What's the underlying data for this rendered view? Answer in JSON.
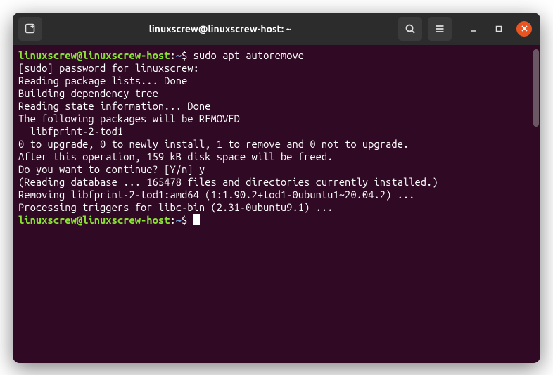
{
  "window": {
    "title": "linuxscrew@linuxscrew-host: ~"
  },
  "prompt": {
    "user_host": "linuxscrew@linuxscrew-host",
    "sep1": ":",
    "path": "~",
    "sep2": "$"
  },
  "session": {
    "command": "sudo apt autoremove",
    "lines": [
      "[sudo] password for linuxscrew:",
      "Reading package lists... Done",
      "Building dependency tree",
      "Reading state information... Done",
      "The following packages will be REMOVED",
      "  libfprint-2-tod1",
      "0 to upgrade, 0 to newly install, 1 to remove and 0 not to upgrade.",
      "After this operation, 159 kB disk space will be freed.",
      "Do you want to continue? [Y/n] y",
      "(Reading database ... 165478 files and directories currently installed.)",
      "Removing libfprint-2-tod1:amd64 (1:1.90.2+tod1-0ubuntu1~20.04.2) ...",
      "Processing triggers for libc-bin (2.31-0ubuntu9.1) ..."
    ]
  }
}
